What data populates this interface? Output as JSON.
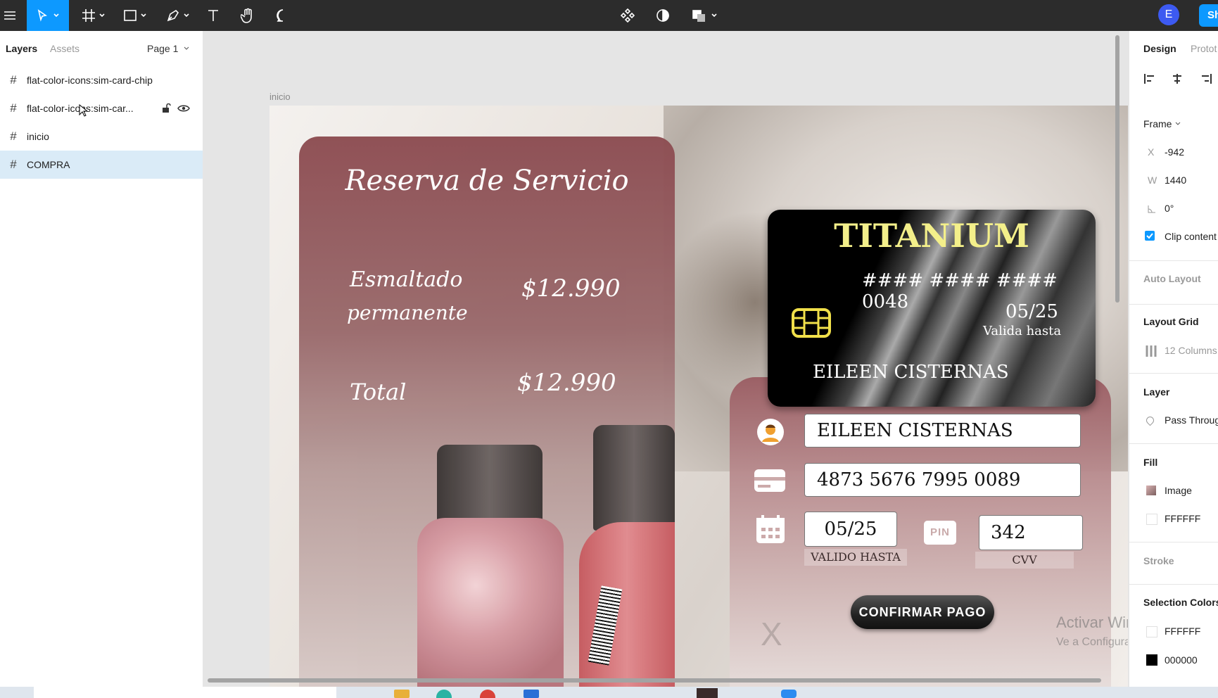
{
  "toolbar": {
    "avatar_letter": "E",
    "share_label": "Sh"
  },
  "left_panel": {
    "tabs": [
      "Layers",
      "Assets"
    ],
    "page_selector": "Page 1",
    "layers": [
      {
        "name": "flat-color-icons:sim-card-chip"
      },
      {
        "name": "flat-color-icons:sim-car..."
      },
      {
        "name": "inicio"
      },
      {
        "name": "COMPRA",
        "selected": true
      }
    ]
  },
  "canvas": {
    "frame_label": "inicio",
    "service_card": {
      "title": "Reserva de Servicio",
      "item_line1": "Esmaltado",
      "item_line2": "permanente",
      "item_price": "$12.990",
      "total_label": "Total",
      "total_price": "$12.990"
    },
    "credit_card": {
      "brand": "TITANIUM",
      "masked_number": "#### #### #### 0048",
      "expiry": "05/25",
      "expiry_label": "Valida hasta",
      "holder": "EILEEN CISTERNAS",
      "brand_color": "#f3ef8a"
    },
    "form": {
      "name_value": "EILEEN CISTERNAS",
      "number_value": "4873 5676 7995 0089",
      "expiry_value": "05/25",
      "expiry_caption": "VALIDO HASTA",
      "pin_label": "PIN",
      "cvv_value": "342",
      "cvv_caption": "CVV",
      "confirm_button": "CONFIRMAR PAGO",
      "close_glyph": "X"
    },
    "watermark": {
      "line1": "Activar Windows",
      "line2": "Ve a Configuración para activa"
    }
  },
  "right_panel": {
    "tabs": [
      "Design",
      "Protot"
    ],
    "frame_label": "Frame",
    "x_label": "X",
    "x_value": "-942",
    "w_label": "W",
    "w_value": "1440",
    "rotation_value": "0°",
    "clip_content": "Clip content",
    "auto_layout": "Auto Layout",
    "layout_grid": "Layout Grid",
    "grid_value": "12 Columns",
    "layer_head": "Layer",
    "blend_value": "Pass Throug",
    "fill_head": "Fill",
    "fill_image": "Image",
    "fill_color": "FFFFFF",
    "stroke_head": "Stroke",
    "selection_colors": "Selection Colors",
    "sel_color_1": "FFFFFF",
    "sel_color_2": "000000"
  },
  "colors": {
    "accent": "#0d99ff",
    "selected_row": "#daebf7",
    "toolbar": "#2c2c2c",
    "card_rose": "#8f5357"
  }
}
